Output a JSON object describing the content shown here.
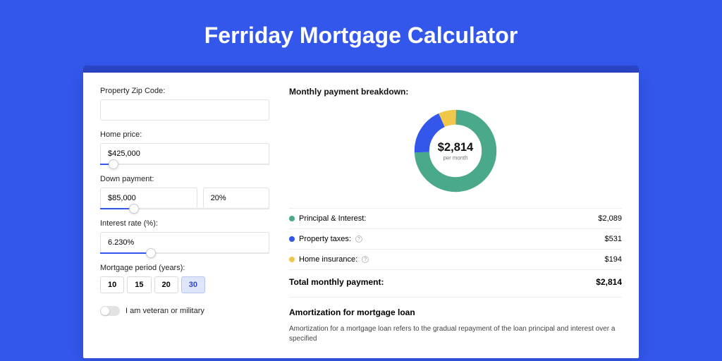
{
  "page": {
    "title": "Ferriday Mortgage Calculator"
  },
  "form": {
    "zip": {
      "label": "Property Zip Code:",
      "value": ""
    },
    "price": {
      "label": "Home price:",
      "value": "$425,000",
      "slider_pct": 8
    },
    "down": {
      "label": "Down payment:",
      "value": "$85,000",
      "pct": "20%",
      "slider_pct": 20
    },
    "rate": {
      "label": "Interest rate (%):",
      "value": "6.230%",
      "slider_pct": 30
    },
    "period": {
      "label": "Mortgage period (years):",
      "options": [
        "10",
        "15",
        "20",
        "30"
      ],
      "selected": "30"
    },
    "veteran": {
      "label": "I am veteran or military",
      "checked": false
    }
  },
  "breakdown": {
    "title": "Monthly payment breakdown:",
    "center_value": "$2,814",
    "center_label": "per month",
    "items": [
      {
        "label": "Principal & Interest:",
        "value": "$2,089",
        "color": "#4aa98a",
        "info": false
      },
      {
        "label": "Property taxes:",
        "value": "$531",
        "color": "#3457eb",
        "info": true
      },
      {
        "label": "Home insurance:",
        "value": "$194",
        "color": "#f1c749",
        "info": true
      }
    ],
    "total_label": "Total monthly payment:",
    "total_value": "$2,814"
  },
  "amortization": {
    "title": "Amortization for mortgage loan",
    "text": "Amortization for a mortgage loan refers to the gradual repayment of the loan principal and interest over a specified"
  },
  "chart_data": {
    "type": "pie",
    "title": "Monthly payment breakdown",
    "series": [
      {
        "name": "Principal & Interest",
        "value": 2089,
        "color": "#4aa98a"
      },
      {
        "name": "Property taxes",
        "value": 531,
        "color": "#3457eb"
      },
      {
        "name": "Home insurance",
        "value": 194,
        "color": "#f1c749"
      }
    ],
    "total": 2814,
    "center_label": "$2,814 per month"
  }
}
